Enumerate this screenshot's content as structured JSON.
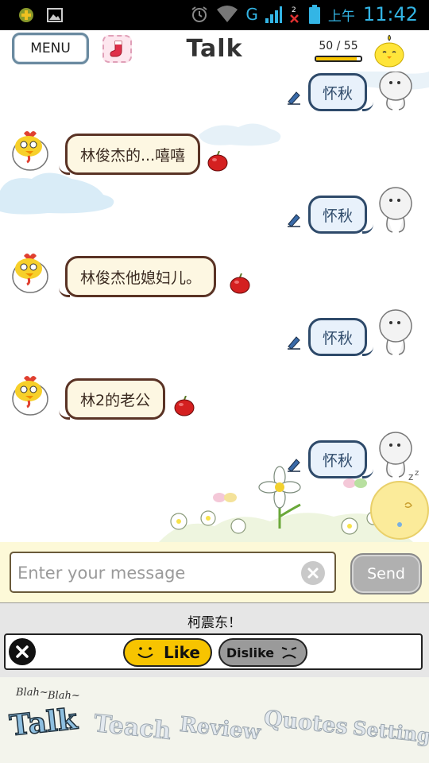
{
  "status_bar": {
    "ampm": "上午",
    "time": "11:42",
    "network": "G",
    "icons": [
      "game-controller-icon",
      "image-icon",
      "alarm-icon",
      "wifi-icon",
      "signal-icon",
      "no-signal-icon",
      "battery-icon"
    ]
  },
  "header": {
    "menu_label": "MENU",
    "title": "Talk",
    "counter": "50 / 55",
    "counter_fraction": 0.909
  },
  "messages": [
    {
      "side": "right",
      "text": "怀秋"
    },
    {
      "side": "left",
      "text": "林俊杰的...嘻嘻"
    },
    {
      "side": "right",
      "text": "怀秋"
    },
    {
      "side": "left",
      "text": "林俊杰他媳妇儿。"
    },
    {
      "side": "right",
      "text": "怀秋"
    },
    {
      "side": "left",
      "text": "林2的老公"
    },
    {
      "side": "right",
      "text": "怀秋"
    }
  ],
  "input": {
    "placeholder": "Enter your message",
    "value": "",
    "send_label": "Send"
  },
  "feedback": {
    "title": "柯震东！",
    "like_label": "Like",
    "dislike_label": "Dislike"
  },
  "bottom_nav": {
    "blah": [
      "Blah~",
      "Blah~"
    ],
    "items": [
      {
        "label": "Talk",
        "active": true
      },
      {
        "label": "Teach",
        "active": false
      },
      {
        "label": "Review",
        "active": false
      },
      {
        "label": "Quotes",
        "active": false
      },
      {
        "label": "Setting",
        "active": false
      }
    ]
  },
  "colors": {
    "status_accent": "#33b5e5",
    "bubble_left_bg": "#fdf7e2",
    "bubble_left_border": "#5a3325",
    "bubble_right_bg": "#e8f1fb",
    "bubble_right_border": "#2e4a6a",
    "like_yellow": "#f7c400",
    "dislike_gray": "#9a9a9a"
  }
}
